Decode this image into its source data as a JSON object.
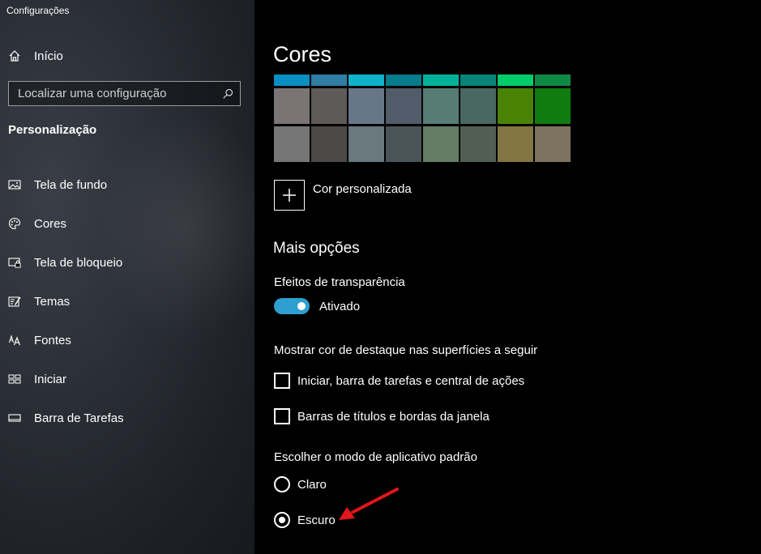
{
  "window": {
    "title": "Configurações"
  },
  "sidebar": {
    "home_label": "Início",
    "search": {
      "placeholder": "Localizar uma configuração"
    },
    "section_heading": "Personalização",
    "items": [
      {
        "label": "Tela de fundo",
        "icon": "picture-icon"
      },
      {
        "label": "Cores",
        "icon": "palette-icon"
      },
      {
        "label": "Tela de bloqueio",
        "icon": "lock-screen-icon"
      },
      {
        "label": "Temas",
        "icon": "themes-icon"
      },
      {
        "label": "Fontes",
        "icon": "fonts-icon"
      },
      {
        "label": "Iniciar",
        "icon": "start-icon"
      },
      {
        "label": "Barra de Tarefas",
        "icon": "taskbar-icon"
      }
    ]
  },
  "main": {
    "title": "Cores",
    "swatches": {
      "top_row": [
        "#0a8fc4",
        "#2f7ea3",
        "#0eb3c9",
        "#067b8c",
        "#02b19a",
        "#05857a",
        "#00cc6a",
        "#0f8a44"
      ],
      "row1": [
        "#7a7574",
        "#5d5a58",
        "#68768a",
        "#515c6b",
        "#567c73",
        "#486860",
        "#498205",
        "#107c10"
      ],
      "row2": [
        "#767676",
        "#4c4a48",
        "#69797e",
        "#4a5459",
        "#647c64",
        "#525e54",
        "#847545",
        "#7e735f"
      ]
    },
    "custom_color_label": "Cor personalizada",
    "more_options_heading": "Mais opções",
    "transparency": {
      "label": "Efeitos de transparência",
      "state_label": "Ativado",
      "on": true
    },
    "accent_surfaces": {
      "label": "Mostrar cor de destaque nas superfícies a seguir",
      "options": [
        {
          "label": "Iniciar, barra de tarefas e central de ações",
          "checked": false
        },
        {
          "label": "Barras de títulos e bordas da janela",
          "checked": false
        }
      ]
    },
    "app_mode": {
      "label": "Escolher o modo de aplicativo padrão",
      "options": [
        {
          "label": "Claro",
          "selected": false
        },
        {
          "label": "Escuro",
          "selected": true
        }
      ]
    },
    "annotation_color": "#e0161b"
  }
}
